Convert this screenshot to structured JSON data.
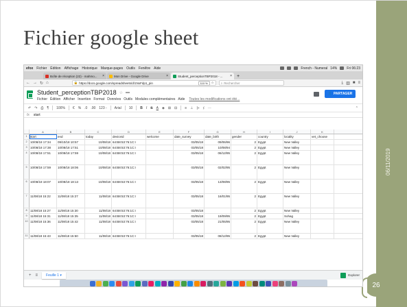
{
  "slide": {
    "title": "Fichier google sheet",
    "date": "06/11/2019",
    "page_number": "26",
    "accent_color": "#9aa47a"
  },
  "menubar": {
    "app": "efox",
    "items": [
      "Fichier",
      "Édition",
      "Affichage",
      "Historique",
      "Marque-pages",
      "Outils",
      "Fenêtre",
      "Aide"
    ],
    "keyboard": "French - Numeral",
    "battery": "14%",
    "clock": "Fri 06:23"
  },
  "tabs": [
    {
      "label": "Boîte de réception (22) - mahmo...",
      "color": "#d93025",
      "active": false
    },
    {
      "label": "Mon Drive - Google Drive",
      "color": "#fbbc04",
      "active": false
    },
    {
      "label": "Student_perceptionTBP2018 - ...",
      "color": "#0f9d58",
      "active": true
    }
  ],
  "navbar": {
    "url": "https://docs.google.com/spreadsheets/d/1NxFdp1_pin",
    "zoom": "110 %",
    "search_placeholder": "Rechercher"
  },
  "doc": {
    "title": "Student_perceptionTBP2018",
    "menu": [
      "Fichier",
      "Édition",
      "Afficher",
      "Insertion",
      "Format",
      "Données",
      "Outils",
      "Modules complémentaires",
      "Aide"
    ],
    "saved_status": "Toutes les modifications ont été...",
    "share_label": "PARTAGER"
  },
  "toolbar": {
    "zoom": "100%",
    "currency": "€",
    "percent": "%",
    "dec_less": ".0",
    "dec_more": ".00",
    "format": "123 -",
    "font": "Arial",
    "font_size": "10"
  },
  "formula_bar": {
    "fx": "fx",
    "value": "start"
  },
  "columns": [
    "A",
    "B",
    "C",
    "D",
    "E",
    "F",
    "G",
    "H",
    "I",
    "J",
    "K"
  ],
  "rows": [
    {
      "n": "1",
      "tall": false,
      "cells": [
        "start",
        "end",
        "today",
        "deviceid",
        "welcome",
        "date_survey",
        "date_birth",
        "gender",
        "country",
        "locality",
        "vet_choose"
      ]
    },
    {
      "n": "2",
      "tall": false,
      "cells": [
        "10/08/18 17:34",
        "09/10/18 10:57",
        "10/08/18",
        "64:B8:53:76:1C:I",
        "",
        "03/05/18",
        "09/06/96",
        "2",
        "Egypt",
        "New Valley",
        ""
      ]
    },
    {
      "n": "3",
      "tall": false,
      "cells": [
        "10/08/18 17:38",
        "10/08/18 17:51",
        "10/08/18",
        "64:B8:53:76:1C:I",
        "",
        "03/05/18",
        "10/08/94",
        "2",
        "Egypt",
        "New Valley",
        ""
      ]
    },
    {
      "n": "4",
      "tall": true,
      "cells": [
        "10/08/18 17:51",
        "10/08/18 17:59",
        "10/08/18",
        "64:B8:53:76:1C:I",
        "",
        "03/05/18",
        "06/12/95",
        "2",
        "Egypt",
        "New Valley",
        ""
      ]
    },
    {
      "n": "5",
      "tall": true,
      "cells": [
        "10/08/18 17:59",
        "10/08/18 18:06",
        "10/08/18",
        "64:B8:53:76:1C:I",
        "",
        "03/05/18",
        "02/02/95",
        "2",
        "Egypt",
        "New Valley",
        ""
      ]
    },
    {
      "n": "6",
      "tall": true,
      "cells": [
        "10/08/18 18:07",
        "10/08/18 18:13",
        "10/08/18",
        "64:B8:53:76:1C:I",
        "",
        "03/05/18",
        "13/08/95",
        "2",
        "Egypt",
        "New Valley",
        ""
      ]
    },
    {
      "n": "7",
      "tall": true,
      "cells": [
        "11/08/18 15:22",
        "11/08/18 15:27",
        "11/08/18",
        "64:B8:53:76:1C:I",
        "",
        "03/05/18",
        "16/01/95",
        "2",
        "Egypt",
        "New Valley",
        ""
      ]
    },
    {
      "n": "8",
      "tall": false,
      "cells": [
        "11/08/18 15:27",
        "11/08/18 15:30",
        "11/08/18",
        "64:B8:53:76:1C:I",
        "",
        "03/05/18",
        "",
        "2",
        "Egypt",
        "New Valley",
        ""
      ]
    },
    {
      "n": "9",
      "tall": false,
      "cells": [
        "11/08/18 15:31",
        "11/08/18 15:35",
        "11/08/18",
        "64:B8:53:76:1C:I",
        "",
        "03/05/18",
        "19/09/95",
        "2",
        "Egypt",
        "Sohag",
        ""
      ]
    },
    {
      "n": "10",
      "tall": true,
      "cells": [
        "11/08/18 15:36",
        "11/08/18 15:42",
        "11/08/18",
        "64:B8:53:76:1C:I",
        "",
        "03/05/18",
        "21/05/95",
        "2",
        "Egypt",
        "New Valley",
        ""
      ]
    },
    {
      "n": "11",
      "tall": false,
      "cells": [
        "11/08/18 15:43",
        "11/08/18 15:50",
        "11/08/18",
        "64:B8:53:76:1C:I",
        "",
        "03/05/18",
        "08/12/95",
        "2",
        "Egypt",
        "New Valley",
        ""
      ]
    }
  ],
  "sheetbar": {
    "add": "+",
    "list": "≡",
    "sheet_name": "Feuille 1",
    "explore_label": "Explorer"
  },
  "dock_colors": [
    "#3b6fd4",
    "#f0b429",
    "#4caf50",
    "#2d8cf0",
    "#e94b3c",
    "#7a57d1",
    "#2fa3e6",
    "#0f9d58",
    "#5c6bc0",
    "#e91e63",
    "#00acc1",
    "#8e24aa",
    "#3949ab",
    "#ffb300",
    "#43a047",
    "#1e88e5",
    "#fb8c00",
    "#d81b60",
    "#546e7a",
    "#26a69a",
    "#7cb342",
    "#5e35b1",
    "#039be5",
    "#f4511e",
    "#c0ca33",
    "#6d4c41",
    "#00897b",
    "#3f51b5",
    "#ec407a",
    "#8d6e63",
    "#78909c",
    "#ab47bc"
  ]
}
